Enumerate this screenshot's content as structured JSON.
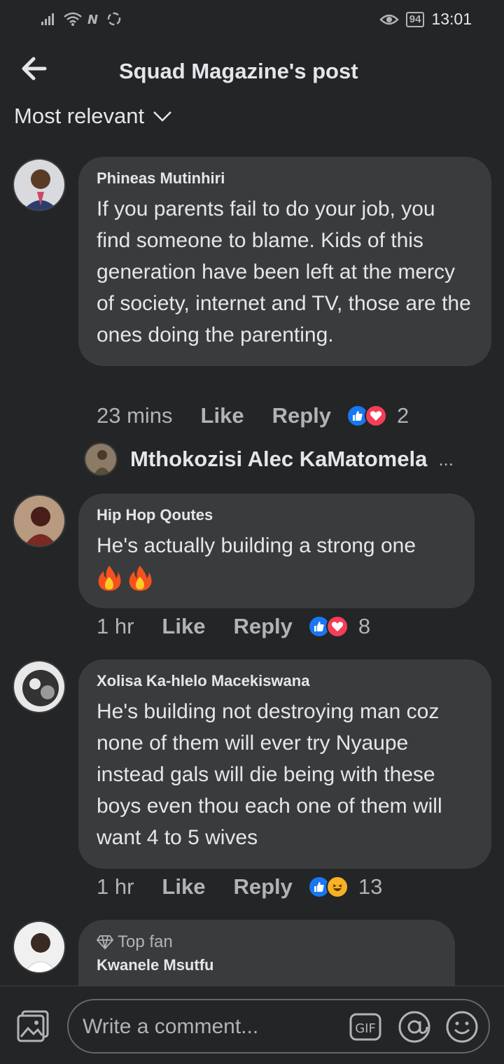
{
  "status_bar": {
    "left_icons": [
      "signal-icon",
      "wifi-icon",
      "nfc-icon",
      "data-saver-icon"
    ],
    "eye_icon": "eye-icon",
    "battery": "94",
    "time": "13:01"
  },
  "header": {
    "title": "Squad Magazine's post"
  },
  "sort": {
    "label": "Most relevant"
  },
  "comments": [
    {
      "author": "Phineas Mutinhiri",
      "text": "If you parents fail to do your job, you find someone to blame. Kids of this generation have been left at the mercy of society, internet and TV, those are the ones doing the parenting.",
      "time": "23 mins",
      "like": "Like",
      "reply": "Reply",
      "reactions": [
        "like",
        "love"
      ],
      "count": "2"
    },
    {
      "author": "Hip Hop Qoutes",
      "text": "He's actually building a strong one",
      "time": "1 hr",
      "like": "Like",
      "reply": "Reply",
      "reactions": [
        "like",
        "love"
      ],
      "count": "8"
    },
    {
      "author": "Xolisa Ka-hlelo Macekiswana",
      "text": "He's building not destroying man coz none of them will ever try Nyaupe instead gals will die being with these boys even thou each one of them will want 4 to 5 wives",
      "time": "1 hr",
      "like": "Like",
      "reply": "Reply",
      "reactions": [
        "like",
        "haha"
      ],
      "count": "13"
    },
    {
      "badge": "Top fan",
      "author": "Kwanele Msutfu"
    }
  ],
  "reply_preview": {
    "author": "Mthokozisi Alec KaMatomela",
    "more": "..."
  },
  "composer": {
    "placeholder": "Write a comment...",
    "gif_label": "GIF"
  }
}
